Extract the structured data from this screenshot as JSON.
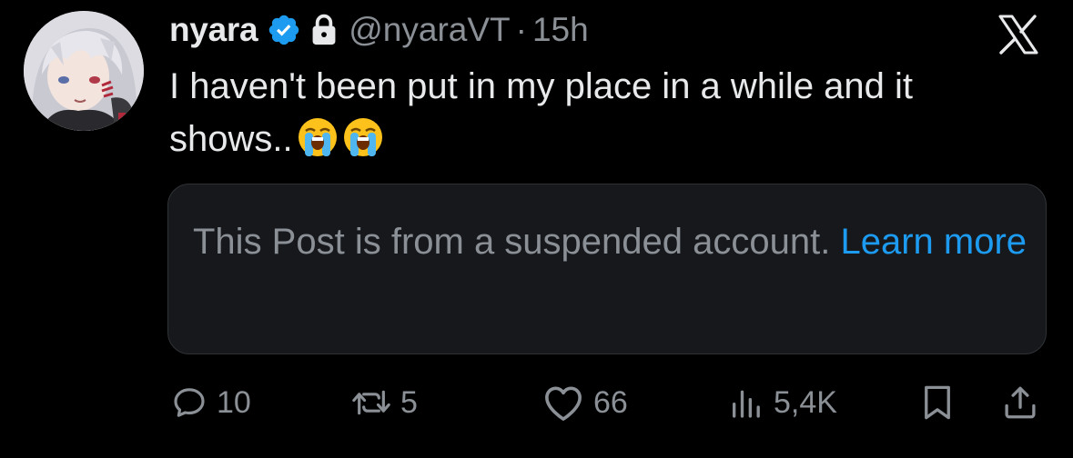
{
  "user": {
    "display_name": "nyara",
    "handle": "@nyaraVT",
    "separator": "·",
    "time": "15h"
  },
  "post": {
    "text": "I haven't been put in my place in a while and it shows..",
    "emojis": [
      "loudly-crying-face",
      "loudly-crying-face"
    ]
  },
  "quote": {
    "message": "This Post is from a suspended account. ",
    "link_label": "Learn more"
  },
  "actions": {
    "replies": "10",
    "reposts": "5",
    "likes": "66",
    "views": "5,4K"
  },
  "colors": {
    "background": "#000000",
    "text": "#e7e9ea",
    "muted": "#8b9096",
    "accent": "#1d9bf0",
    "card": "#16181c"
  },
  "icons": [
    "verified-badge-icon",
    "lock-icon",
    "x-logo-icon",
    "reply-icon",
    "repost-icon",
    "like-icon",
    "views-icon",
    "bookmark-icon",
    "share-icon"
  ]
}
